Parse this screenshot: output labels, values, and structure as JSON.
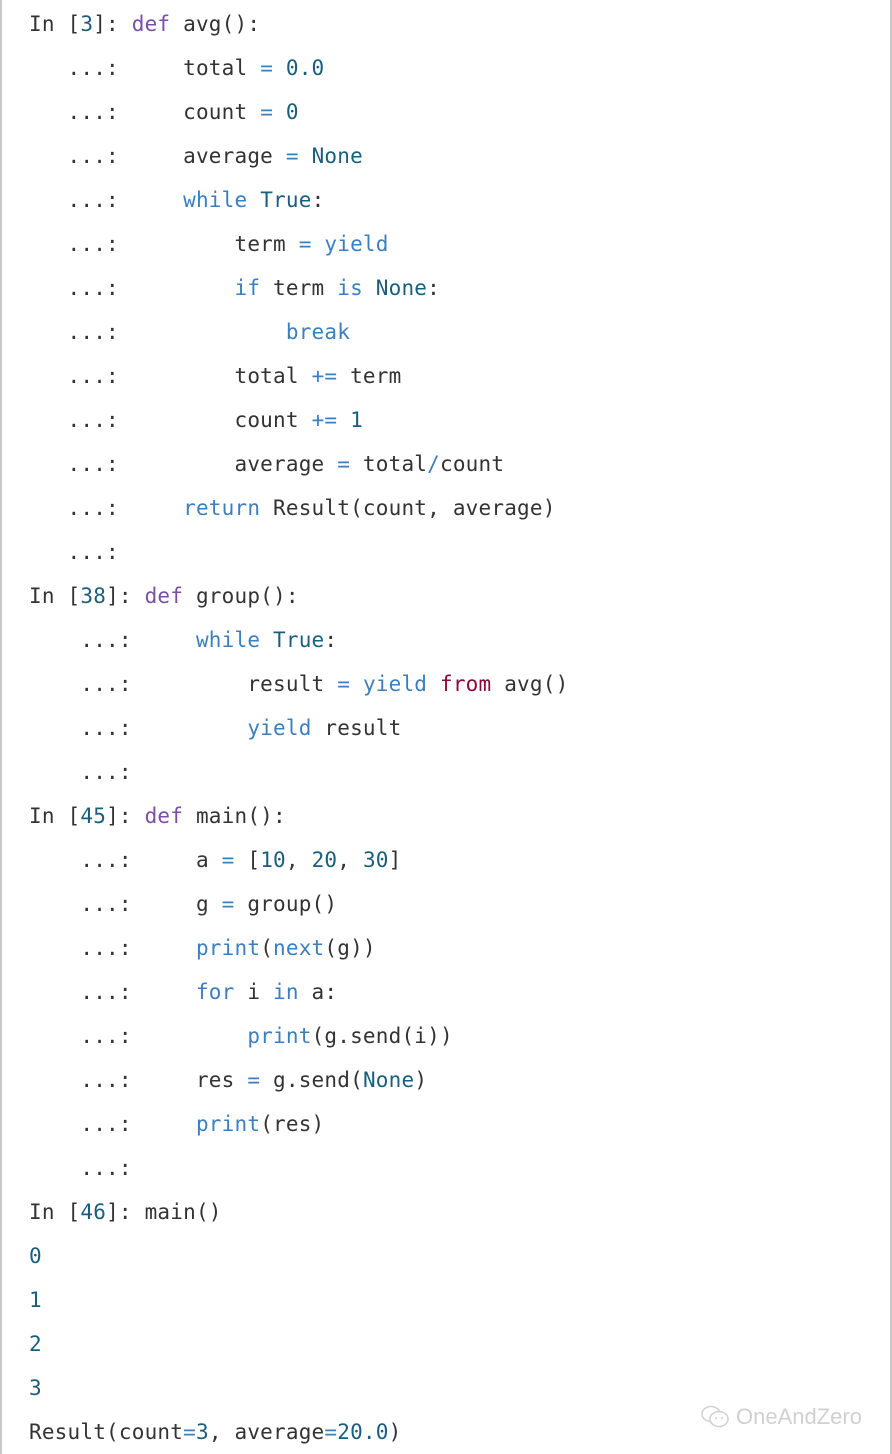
{
  "cells": [
    {
      "prompt_in": "In [",
      "number": "3",
      "prompt_close": "]: ",
      "continuation": "   ...: ",
      "lines": [
        [
          {
            "t": "def",
            "c": "def"
          },
          {
            "t": " avg():",
            "c": ""
          }
        ],
        [
          {
            "t": "    total ",
            "c": ""
          },
          {
            "t": "=",
            "c": "op"
          },
          {
            "t": " ",
            "c": ""
          },
          {
            "t": "0.0",
            "c": "num"
          }
        ],
        [
          {
            "t": "    count ",
            "c": ""
          },
          {
            "t": "=",
            "c": "op"
          },
          {
            "t": " ",
            "c": ""
          },
          {
            "t": "0",
            "c": "num"
          }
        ],
        [
          {
            "t": "    average ",
            "c": ""
          },
          {
            "t": "=",
            "c": "op"
          },
          {
            "t": " ",
            "c": ""
          },
          {
            "t": "None",
            "c": "const"
          }
        ],
        [
          {
            "t": "    ",
            "c": ""
          },
          {
            "t": "while",
            "c": "kw"
          },
          {
            "t": " ",
            "c": ""
          },
          {
            "t": "True",
            "c": "const"
          },
          {
            "t": ":",
            "c": ""
          }
        ],
        [
          {
            "t": "        term ",
            "c": ""
          },
          {
            "t": "=",
            "c": "op"
          },
          {
            "t": " ",
            "c": ""
          },
          {
            "t": "yield",
            "c": "kw"
          }
        ],
        [
          {
            "t": "        ",
            "c": ""
          },
          {
            "t": "if",
            "c": "kw"
          },
          {
            "t": " term ",
            "c": ""
          },
          {
            "t": "is",
            "c": "kw"
          },
          {
            "t": " ",
            "c": ""
          },
          {
            "t": "None",
            "c": "const"
          },
          {
            "t": ":",
            "c": ""
          }
        ],
        [
          {
            "t": "            ",
            "c": ""
          },
          {
            "t": "break",
            "c": "kw"
          }
        ],
        [
          {
            "t": "        total ",
            "c": ""
          },
          {
            "t": "+=",
            "c": "op"
          },
          {
            "t": " term",
            "c": ""
          }
        ],
        [
          {
            "t": "        count ",
            "c": ""
          },
          {
            "t": "+=",
            "c": "op"
          },
          {
            "t": " ",
            "c": ""
          },
          {
            "t": "1",
            "c": "num"
          }
        ],
        [
          {
            "t": "        average ",
            "c": ""
          },
          {
            "t": "=",
            "c": "op"
          },
          {
            "t": " total",
            "c": ""
          },
          {
            "t": "/",
            "c": "op"
          },
          {
            "t": "count",
            "c": ""
          }
        ],
        [
          {
            "t": "    ",
            "c": ""
          },
          {
            "t": "return",
            "c": "kw"
          },
          {
            "t": " Result(count, average)",
            "c": ""
          }
        ],
        []
      ]
    },
    {
      "prompt_in": "In [",
      "number": "38",
      "prompt_close": "]: ",
      "continuation": "    ...: ",
      "lines": [
        [
          {
            "t": "def",
            "c": "def"
          },
          {
            "t": " group():",
            "c": ""
          }
        ],
        [
          {
            "t": "    ",
            "c": ""
          },
          {
            "t": "while",
            "c": "kw"
          },
          {
            "t": " ",
            "c": ""
          },
          {
            "t": "True",
            "c": "const"
          },
          {
            "t": ":",
            "c": ""
          }
        ],
        [
          {
            "t": "        result ",
            "c": ""
          },
          {
            "t": "=",
            "c": "op"
          },
          {
            "t": " ",
            "c": ""
          },
          {
            "t": "yield",
            "c": "kw"
          },
          {
            "t": " ",
            "c": ""
          },
          {
            "t": "from",
            "c": "from"
          },
          {
            "t": " avg()",
            "c": ""
          }
        ],
        [
          {
            "t": "        ",
            "c": ""
          },
          {
            "t": "yield",
            "c": "kw"
          },
          {
            "t": " result",
            "c": ""
          }
        ],
        []
      ]
    },
    {
      "prompt_in": "In [",
      "number": "45",
      "prompt_close": "]: ",
      "continuation": "    ...: ",
      "lines": [
        [
          {
            "t": "def",
            "c": "def"
          },
          {
            "t": " main():",
            "c": ""
          }
        ],
        [
          {
            "t": "    a ",
            "c": ""
          },
          {
            "t": "=",
            "c": "op"
          },
          {
            "t": " [",
            "c": ""
          },
          {
            "t": "10",
            "c": "num"
          },
          {
            "t": ", ",
            "c": ""
          },
          {
            "t": "20",
            "c": "num"
          },
          {
            "t": ", ",
            "c": ""
          },
          {
            "t": "30",
            "c": "num"
          },
          {
            "t": "]",
            "c": ""
          }
        ],
        [
          {
            "t": "    g ",
            "c": ""
          },
          {
            "t": "=",
            "c": "op"
          },
          {
            "t": " group()",
            "c": ""
          }
        ],
        [
          {
            "t": "    ",
            "c": ""
          },
          {
            "t": "print",
            "c": "kw"
          },
          {
            "t": "(",
            "c": ""
          },
          {
            "t": "next",
            "c": "kw"
          },
          {
            "t": "(g))",
            "c": ""
          }
        ],
        [
          {
            "t": "    ",
            "c": ""
          },
          {
            "t": "for",
            "c": "kw"
          },
          {
            "t": " i ",
            "c": ""
          },
          {
            "t": "in",
            "c": "kw"
          },
          {
            "t": " a:",
            "c": ""
          }
        ],
        [
          {
            "t": "        ",
            "c": ""
          },
          {
            "t": "print",
            "c": "kw"
          },
          {
            "t": "(g.send(i))",
            "c": ""
          }
        ],
        [
          {
            "t": "    res ",
            "c": ""
          },
          {
            "t": "=",
            "c": "op"
          },
          {
            "t": " g.send(",
            "c": ""
          },
          {
            "t": "None",
            "c": "const"
          },
          {
            "t": ")",
            "c": ""
          }
        ],
        [
          {
            "t": "    ",
            "c": ""
          },
          {
            "t": "print",
            "c": "kw"
          },
          {
            "t": "(res)",
            "c": ""
          }
        ],
        []
      ]
    },
    {
      "prompt_in": "In [",
      "number": "46",
      "prompt_close": "]: ",
      "continuation": "",
      "lines": [
        [
          {
            "t": "main()",
            "c": ""
          }
        ]
      ]
    }
  ],
  "output": [
    [
      {
        "t": "0",
        "c": "out"
      }
    ],
    [
      {
        "t": "1",
        "c": "out"
      }
    ],
    [
      {
        "t": "2",
        "c": "out"
      }
    ],
    [
      {
        "t": "3",
        "c": "out"
      }
    ],
    [
      {
        "t": "Result(count",
        "c": ""
      },
      {
        "t": "=",
        "c": "op"
      },
      {
        "t": "3",
        "c": "num"
      },
      {
        "t": ", average",
        "c": ""
      },
      {
        "t": "=",
        "c": "op"
      },
      {
        "t": "20.0",
        "c": "num"
      },
      {
        "t": ")",
        "c": ""
      }
    ]
  ],
  "watermark": {
    "icon": "wechat-icon",
    "text": "OneAndZero"
  }
}
